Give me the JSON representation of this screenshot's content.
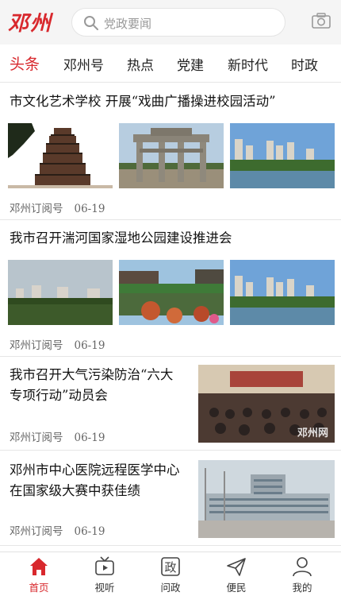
{
  "header": {
    "logo": "邓州",
    "search_placeholder": "党政要闻",
    "search_icon": "search-icon",
    "camera_icon": "camera-icon"
  },
  "tabs": [
    "头条",
    "邓州号",
    "热点",
    "党建",
    "新时代",
    "时政"
  ],
  "active_tab": "头条",
  "articles": [
    {
      "title": "市文化艺术学校 开展“戏曲广播操进校园活动”",
      "source": "邓州订阅号",
      "date": "06-19"
    },
    {
      "title": "我市召开湍河国家湿地公园建设推进会",
      "source": "邓州订阅号",
      "date": "06-19"
    },
    {
      "title_line1": "我市召开大气污染防治“六大",
      "title_line2": "专项行动”动员会",
      "source": "邓州订阅号",
      "date": "06-19",
      "watermark": "邓州网"
    },
    {
      "title_line1": "邓州市中心医院远程医学中心",
      "title_line2": "在国家级大赛中获佳绩",
      "source": "邓州订阅号",
      "date": "06-19"
    }
  ],
  "bottom_nav": [
    {
      "label": "首页",
      "icon": "home-icon"
    },
    {
      "label": "视听",
      "icon": "tv-icon"
    },
    {
      "label": "问政",
      "icon": "wenzheng-icon",
      "glyph": "政"
    },
    {
      "label": "便民",
      "icon": "send-icon"
    },
    {
      "label": "我的",
      "icon": "user-icon"
    }
  ],
  "colors": {
    "accent": "#d8282d",
    "text": "#222222",
    "meta": "#666666"
  }
}
